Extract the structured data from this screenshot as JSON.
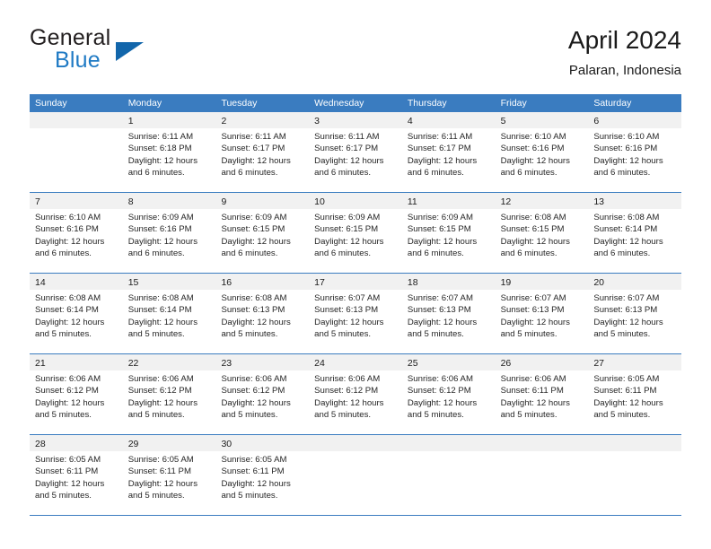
{
  "brand": {
    "name_part1": "General",
    "name_part2": "Blue",
    "triangle_icon": "brand-triangle-icon",
    "color_primary": "#1266ab",
    "color_text": "#231f20"
  },
  "header": {
    "title": "April 2024",
    "location": "Palaran, Indonesia"
  },
  "calendar": {
    "header_bg": "#3a7cc0",
    "day_band_bg": "#f1f1f1",
    "weekdays": [
      "Sunday",
      "Monday",
      "Tuesday",
      "Wednesday",
      "Thursday",
      "Friday",
      "Saturday"
    ],
    "weeks": [
      [
        {
          "day": "",
          "sunrise": "",
          "sunset": "",
          "daylight_line1": "",
          "daylight_line2": ""
        },
        {
          "day": "1",
          "sunrise": "Sunrise: 6:11 AM",
          "sunset": "Sunset: 6:18 PM",
          "daylight_line1": "Daylight: 12 hours",
          "daylight_line2": "and 6 minutes."
        },
        {
          "day": "2",
          "sunrise": "Sunrise: 6:11 AM",
          "sunset": "Sunset: 6:17 PM",
          "daylight_line1": "Daylight: 12 hours",
          "daylight_line2": "and 6 minutes."
        },
        {
          "day": "3",
          "sunrise": "Sunrise: 6:11 AM",
          "sunset": "Sunset: 6:17 PM",
          "daylight_line1": "Daylight: 12 hours",
          "daylight_line2": "and 6 minutes."
        },
        {
          "day": "4",
          "sunrise": "Sunrise: 6:11 AM",
          "sunset": "Sunset: 6:17 PM",
          "daylight_line1": "Daylight: 12 hours",
          "daylight_line2": "and 6 minutes."
        },
        {
          "day": "5",
          "sunrise": "Sunrise: 6:10 AM",
          "sunset": "Sunset: 6:16 PM",
          "daylight_line1": "Daylight: 12 hours",
          "daylight_line2": "and 6 minutes."
        },
        {
          "day": "6",
          "sunrise": "Sunrise: 6:10 AM",
          "sunset": "Sunset: 6:16 PM",
          "daylight_line1": "Daylight: 12 hours",
          "daylight_line2": "and 6 minutes."
        }
      ],
      [
        {
          "day": "7",
          "sunrise": "Sunrise: 6:10 AM",
          "sunset": "Sunset: 6:16 PM",
          "daylight_line1": "Daylight: 12 hours",
          "daylight_line2": "and 6 minutes."
        },
        {
          "day": "8",
          "sunrise": "Sunrise: 6:09 AM",
          "sunset": "Sunset: 6:16 PM",
          "daylight_line1": "Daylight: 12 hours",
          "daylight_line2": "and 6 minutes."
        },
        {
          "day": "9",
          "sunrise": "Sunrise: 6:09 AM",
          "sunset": "Sunset: 6:15 PM",
          "daylight_line1": "Daylight: 12 hours",
          "daylight_line2": "and 6 minutes."
        },
        {
          "day": "10",
          "sunrise": "Sunrise: 6:09 AM",
          "sunset": "Sunset: 6:15 PM",
          "daylight_line1": "Daylight: 12 hours",
          "daylight_line2": "and 6 minutes."
        },
        {
          "day": "11",
          "sunrise": "Sunrise: 6:09 AM",
          "sunset": "Sunset: 6:15 PM",
          "daylight_line1": "Daylight: 12 hours",
          "daylight_line2": "and 6 minutes."
        },
        {
          "day": "12",
          "sunrise": "Sunrise: 6:08 AM",
          "sunset": "Sunset: 6:15 PM",
          "daylight_line1": "Daylight: 12 hours",
          "daylight_line2": "and 6 minutes."
        },
        {
          "day": "13",
          "sunrise": "Sunrise: 6:08 AM",
          "sunset": "Sunset: 6:14 PM",
          "daylight_line1": "Daylight: 12 hours",
          "daylight_line2": "and 6 minutes."
        }
      ],
      [
        {
          "day": "14",
          "sunrise": "Sunrise: 6:08 AM",
          "sunset": "Sunset: 6:14 PM",
          "daylight_line1": "Daylight: 12 hours",
          "daylight_line2": "and 5 minutes."
        },
        {
          "day": "15",
          "sunrise": "Sunrise: 6:08 AM",
          "sunset": "Sunset: 6:14 PM",
          "daylight_line1": "Daylight: 12 hours",
          "daylight_line2": "and 5 minutes."
        },
        {
          "day": "16",
          "sunrise": "Sunrise: 6:08 AM",
          "sunset": "Sunset: 6:13 PM",
          "daylight_line1": "Daylight: 12 hours",
          "daylight_line2": "and 5 minutes."
        },
        {
          "day": "17",
          "sunrise": "Sunrise: 6:07 AM",
          "sunset": "Sunset: 6:13 PM",
          "daylight_line1": "Daylight: 12 hours",
          "daylight_line2": "and 5 minutes."
        },
        {
          "day": "18",
          "sunrise": "Sunrise: 6:07 AM",
          "sunset": "Sunset: 6:13 PM",
          "daylight_line1": "Daylight: 12 hours",
          "daylight_line2": "and 5 minutes."
        },
        {
          "day": "19",
          "sunrise": "Sunrise: 6:07 AM",
          "sunset": "Sunset: 6:13 PM",
          "daylight_line1": "Daylight: 12 hours",
          "daylight_line2": "and 5 minutes."
        },
        {
          "day": "20",
          "sunrise": "Sunrise: 6:07 AM",
          "sunset": "Sunset: 6:13 PM",
          "daylight_line1": "Daylight: 12 hours",
          "daylight_line2": "and 5 minutes."
        }
      ],
      [
        {
          "day": "21",
          "sunrise": "Sunrise: 6:06 AM",
          "sunset": "Sunset: 6:12 PM",
          "daylight_line1": "Daylight: 12 hours",
          "daylight_line2": "and 5 minutes."
        },
        {
          "day": "22",
          "sunrise": "Sunrise: 6:06 AM",
          "sunset": "Sunset: 6:12 PM",
          "daylight_line1": "Daylight: 12 hours",
          "daylight_line2": "and 5 minutes."
        },
        {
          "day": "23",
          "sunrise": "Sunrise: 6:06 AM",
          "sunset": "Sunset: 6:12 PM",
          "daylight_line1": "Daylight: 12 hours",
          "daylight_line2": "and 5 minutes."
        },
        {
          "day": "24",
          "sunrise": "Sunrise: 6:06 AM",
          "sunset": "Sunset: 6:12 PM",
          "daylight_line1": "Daylight: 12 hours",
          "daylight_line2": "and 5 minutes."
        },
        {
          "day": "25",
          "sunrise": "Sunrise: 6:06 AM",
          "sunset": "Sunset: 6:12 PM",
          "daylight_line1": "Daylight: 12 hours",
          "daylight_line2": "and 5 minutes."
        },
        {
          "day": "26",
          "sunrise": "Sunrise: 6:06 AM",
          "sunset": "Sunset: 6:11 PM",
          "daylight_line1": "Daylight: 12 hours",
          "daylight_line2": "and 5 minutes."
        },
        {
          "day": "27",
          "sunrise": "Sunrise: 6:05 AM",
          "sunset": "Sunset: 6:11 PM",
          "daylight_line1": "Daylight: 12 hours",
          "daylight_line2": "and 5 minutes."
        }
      ],
      [
        {
          "day": "28",
          "sunrise": "Sunrise: 6:05 AM",
          "sunset": "Sunset: 6:11 PM",
          "daylight_line1": "Daylight: 12 hours",
          "daylight_line2": "and 5 minutes."
        },
        {
          "day": "29",
          "sunrise": "Sunrise: 6:05 AM",
          "sunset": "Sunset: 6:11 PM",
          "daylight_line1": "Daylight: 12 hours",
          "daylight_line2": "and 5 minutes."
        },
        {
          "day": "30",
          "sunrise": "Sunrise: 6:05 AM",
          "sunset": "Sunset: 6:11 PM",
          "daylight_line1": "Daylight: 12 hours",
          "daylight_line2": "and 5 minutes."
        },
        {
          "day": "",
          "sunrise": "",
          "sunset": "",
          "daylight_line1": "",
          "daylight_line2": ""
        },
        {
          "day": "",
          "sunrise": "",
          "sunset": "",
          "daylight_line1": "",
          "daylight_line2": ""
        },
        {
          "day": "",
          "sunrise": "",
          "sunset": "",
          "daylight_line1": "",
          "daylight_line2": ""
        },
        {
          "day": "",
          "sunrise": "",
          "sunset": "",
          "daylight_line1": "",
          "daylight_line2": ""
        }
      ]
    ]
  }
}
